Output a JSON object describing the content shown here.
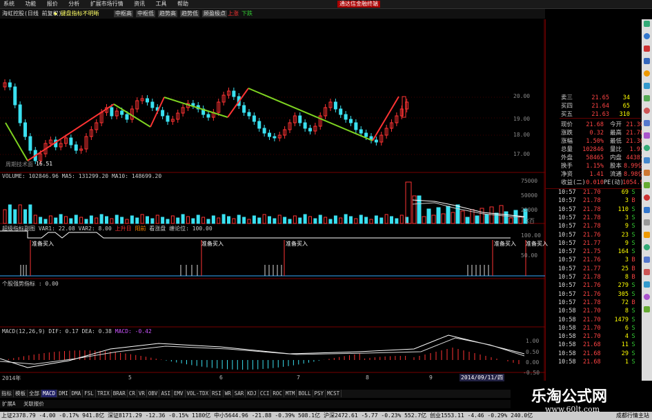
{
  "menu": {
    "items": [
      "系统",
      "功能",
      "报价",
      "分析",
      "扩展市场行情",
      "资讯",
      "工具",
      "帮助"
    ],
    "brand": "通达信金融终端"
  },
  "toolbar": {
    "stock": "海虹控股(日线 前复权)",
    "warn": "◆ 键盘指标不明晰",
    "items": [
      "中枢高",
      "中枢低",
      "趋势高",
      "趋势低",
      "顾盈极点",
      "上涨",
      "下跌"
    ]
  },
  "colors": {
    "up": "#ff3333",
    "down": "#3ae0f0",
    "ma1": "#ffffff",
    "ma2": "#ffff00",
    "green": "#7ed321"
  },
  "kline": {
    "low_label": "16.51",
    "watermark": "周期技术面",
    "scale": [
      "20.00",
      "19.00",
      "18.00",
      "17.00"
    ]
  },
  "volume": {
    "title": "VOLUME: 102846.96  MA5: 131299.20  MA10: 148699.20",
    "scale": [
      "75000",
      "50000",
      "25000"
    ],
    "unit": "X百"
  },
  "ind1": {
    "title_parts": [
      "超级指标副图",
      "VAR1: 22.08",
      "VAR2: 8.00",
      "上升日",
      "阳前",
      "看涨盘",
      "缠论位: 100.00"
    ],
    "buy_label": "准备买入",
    "scale": [
      "100.00",
      "50.00"
    ]
  },
  "ind2": {
    "title": "个股强势指标 : 0.00"
  },
  "macd": {
    "title": "MACD(12,26,9) DIF: 0.17  DEA: 0.38",
    "macd_val": "MACD: -0.42",
    "scale": [
      "1.00",
      "0.50",
      "0.00",
      "-0.50"
    ]
  },
  "axis": {
    "labels": [
      "2014年",
      "5",
      "6",
      "7",
      "8",
      "9"
    ],
    "date_box": "2014/09/11/四"
  },
  "tabs": [
    "指标",
    "模板",
    "全部",
    "MACD",
    "DMI",
    "DMA",
    "FSL",
    "TRIX",
    "BRAR",
    "CR",
    "VR",
    "OBV",
    "ASI",
    "EMV",
    "VOL-TDX",
    "RSI",
    "WR",
    "SAR",
    "KDJ",
    "CCI",
    "ROC",
    "MTM",
    "BOLL",
    "PSY",
    "MCST"
  ],
  "tabs_row2": [
    "扩展A",
    "关联报价"
  ],
  "quotes": {
    "book": [
      {
        "l": "卖三",
        "v": "21.65",
        "n": "34"
      },
      {
        "l": "买四",
        "v": "21.64",
        "n": "65"
      },
      {
        "l": "买五",
        "v": "21.63",
        "n": "310"
      }
    ],
    "stats": [
      {
        "a": "现价",
        "av": "21.68",
        "b": "今开",
        "bv": "21.30"
      },
      {
        "a": "涨跌",
        "av": "0.32",
        "b": "最高",
        "bv": "21.78"
      },
      {
        "a": "涨幅",
        "av": "1.50%",
        "b": "最低",
        "bv": "21.30"
      },
      {
        "a": "总量",
        "av": "102846",
        "b": "量比",
        "bv": "1.91"
      },
      {
        "a": "外盘",
        "av": "58465",
        "b": "内盘",
        "bv": "44381"
      },
      {
        "a": "换手",
        "av": "1.15%",
        "b": "股本",
        "bv": "8.99亿"
      },
      {
        "a": "净资",
        "av": "1.41",
        "b": "流通",
        "bv": "8.98亿"
      },
      {
        "a": "收益(二)",
        "av": "0.010",
        "b": "PE(动)",
        "bv": "1054.9"
      }
    ],
    "ticks": [
      {
        "t": "10:57",
        "p": "21.70",
        "v": "69",
        "s": "S"
      },
      {
        "t": "10:57",
        "p": "21.78",
        "v": "3",
        "s": "B"
      },
      {
        "t": "10:57",
        "p": "21.78",
        "v": "110",
        "s": "S"
      },
      {
        "t": "10:57",
        "p": "21.78",
        "v": "3",
        "s": "S"
      },
      {
        "t": "10:57",
        "p": "21.78",
        "v": "9",
        "s": "S"
      },
      {
        "t": "10:57",
        "p": "21.76",
        "v": "23",
        "s": "S"
      },
      {
        "t": "10:57",
        "p": "21.77",
        "v": "9",
        "s": "S"
      },
      {
        "t": "10:57",
        "p": "21.75",
        "v": "164",
        "s": "S"
      },
      {
        "t": "10:57",
        "p": "21.76",
        "v": "3",
        "s": "B"
      },
      {
        "t": "10:57",
        "p": "21.77",
        "v": "25",
        "s": "B"
      },
      {
        "t": "10:57",
        "p": "21.78",
        "v": "8",
        "s": "B"
      },
      {
        "t": "10:57",
        "p": "21.76",
        "v": "279",
        "s": "S"
      },
      {
        "t": "10:57",
        "p": "21.76",
        "v": "305",
        "s": "S"
      },
      {
        "t": "10:57",
        "p": "21.78",
        "v": "72",
        "s": "B"
      },
      {
        "t": "10:58",
        "p": "21.70",
        "v": "8",
        "s": "S"
      },
      {
        "t": "10:58",
        "p": "21.70",
        "v": "1479",
        "s": "S"
      },
      {
        "t": "10:58",
        "p": "21.70",
        "v": "6",
        "s": "S"
      },
      {
        "t": "10:58",
        "p": "21.70",
        "v": "4",
        "s": "S"
      },
      {
        "t": "10:58",
        "p": "21.68",
        "v": "11",
        "s": "S"
      },
      {
        "t": "10:58",
        "p": "21.68",
        "v": "29",
        "s": "S"
      },
      {
        "t": "10:58",
        "p": "21.68",
        "v": "1",
        "s": "S"
      }
    ]
  },
  "status": "上证2378.79 -4.00 -0.17% 941.8亿  深证8171.29 -12.36 -0.15% 1180亿  中小5644.96 -21.88 -0.39% 508.1亿  沪深2472.61 -5.77 -0.23% 552.7亿  创业1553.11 -4.46 -0.29% 240.0亿",
  "status_right": "成都行情主站",
  "watermark": {
    "title": "乐淘公式网",
    "url": "www.60lt.com"
  }
}
